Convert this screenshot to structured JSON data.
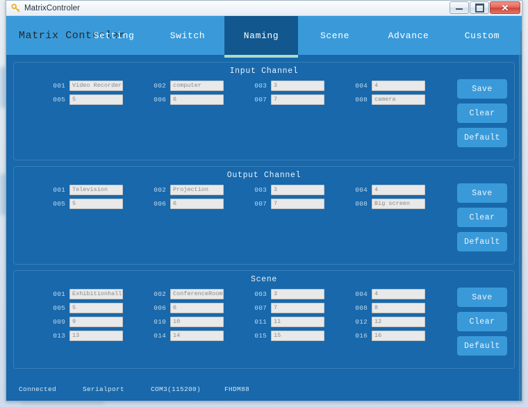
{
  "window": {
    "title": "MatrixControler",
    "icon": "key-icon",
    "controls": {
      "minimize": "minimize-icon",
      "maximize": "maximize-icon",
      "close": "close-icon"
    }
  },
  "header": {
    "brand": "Matrix Controler",
    "nav": [
      {
        "label": "Setting",
        "active": false
      },
      {
        "label": "Switch",
        "active": false
      },
      {
        "label": "Naming",
        "active": true
      },
      {
        "label": "Scene",
        "active": false
      },
      {
        "label": "Advance",
        "active": false
      },
      {
        "label": "Custom",
        "active": false
      }
    ]
  },
  "buttons": {
    "save": "Save",
    "clear": "Clear",
    "default": "Default"
  },
  "panels": [
    {
      "id": "input-channel",
      "title": "Input Channel",
      "rows": [
        [
          {
            "index": "001",
            "value": "Video Recorder"
          },
          {
            "index": "002",
            "value": "computer"
          },
          {
            "index": "003",
            "value": "3"
          },
          {
            "index": "004",
            "value": "4"
          }
        ],
        [
          {
            "index": "005",
            "value": "5"
          },
          {
            "index": "006",
            "value": "6"
          },
          {
            "index": "007",
            "value": "7"
          },
          {
            "index": "008",
            "value": "camera"
          }
        ]
      ]
    },
    {
      "id": "output-channel",
      "title": "Output Channel",
      "rows": [
        [
          {
            "index": "001",
            "value": "Television"
          },
          {
            "index": "002",
            "value": "Projection"
          },
          {
            "index": "003",
            "value": "3"
          },
          {
            "index": "004",
            "value": "4"
          }
        ],
        [
          {
            "index": "005",
            "value": "5"
          },
          {
            "index": "006",
            "value": "6"
          },
          {
            "index": "007",
            "value": "7"
          },
          {
            "index": "008",
            "value": "Big screen"
          }
        ]
      ]
    },
    {
      "id": "scene",
      "title": "Scene",
      "rows": [
        [
          {
            "index": "001",
            "value": "Exhibitionhall"
          },
          {
            "index": "002",
            "value": "ConferenceRoom"
          },
          {
            "index": "003",
            "value": "3"
          },
          {
            "index": "004",
            "value": "4"
          }
        ],
        [
          {
            "index": "005",
            "value": "5"
          },
          {
            "index": "006",
            "value": "6"
          },
          {
            "index": "007",
            "value": "7"
          },
          {
            "index": "008",
            "value": "8"
          }
        ],
        [
          {
            "index": "009",
            "value": "9"
          },
          {
            "index": "010",
            "value": "10"
          },
          {
            "index": "011",
            "value": "11"
          },
          {
            "index": "012",
            "value": "12"
          }
        ],
        [
          {
            "index": "013",
            "value": "13"
          },
          {
            "index": "014",
            "value": "14"
          },
          {
            "index": "015",
            "value": "15"
          },
          {
            "index": "016",
            "value": "16"
          }
        ]
      ]
    }
  ],
  "statusbar": {
    "connection": "Connected",
    "port_type": "Serialport",
    "port": "COM3(115200)",
    "device": "FHDM88"
  },
  "colors": {
    "header_blue": "#3a9ad9",
    "body_blue": "#1868ab",
    "active_tab_blue": "#12588f",
    "active_underline": "#a9dcc8",
    "field_bg": "#e9e9e9"
  }
}
